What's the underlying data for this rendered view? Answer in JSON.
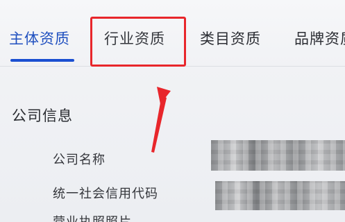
{
  "tabs": [
    {
      "label": "主体资质"
    },
    {
      "label": "行业资质"
    },
    {
      "label": "类目资质"
    },
    {
      "label": "品牌资质"
    }
  ],
  "section": {
    "title": "公司信息",
    "rows": [
      {
        "label": "公司名称"
      },
      {
        "label": "统一社会信用代码"
      },
      {
        "label": "营业执照照片"
      }
    ]
  },
  "colors": {
    "active_tab": "#1f4fbf",
    "annotation": "#e8262b"
  }
}
